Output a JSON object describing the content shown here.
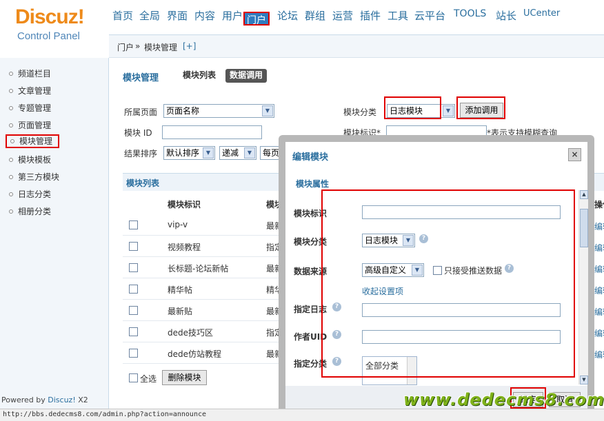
{
  "brand": {
    "logo": "Discuz!",
    "subtitle": "Control Panel"
  },
  "topnav": [
    "首页",
    "全局",
    "界面",
    "内容",
    "用户",
    "门户",
    "论坛",
    "群组",
    "运营",
    "插件",
    "工具",
    "云平台",
    "TOOLS",
    "站长",
    "UCenter"
  ],
  "active_nav": "门户",
  "breadcrumb": {
    "section": "门户",
    "sep": "»",
    "page": "模块管理",
    "add": "[+]"
  },
  "sidebar": [
    "频道栏目",
    "文章管理",
    "专题管理",
    "页面管理",
    "模块管理",
    "模块模板",
    "第三方模块",
    "日志分类",
    "相册分类"
  ],
  "active_sidebar": "模块管理",
  "powered": {
    "prefix": "Powered by",
    "brand": "Discuz!",
    "version": "X2"
  },
  "status_url": "http://bbs.dedecms8.com/admin.php?action=announce",
  "main": {
    "title": "模块管理",
    "tabs": [
      "模块列表",
      "数据调用"
    ],
    "active_tab": "数据调用",
    "filters": {
      "page_label": "所属页面",
      "page_value": "页面名称",
      "id_label": "模块 ID",
      "sort_label": "结果排序",
      "sort_value": "默认排序",
      "order_value": "递减",
      "perpage_value": "每页",
      "category_label": "模块分类",
      "category_value": "日志模块",
      "add_button": "添加调用",
      "tag_label": "模块标识*",
      "tag_hint": "*表示支持模糊查询"
    },
    "list_title": "模块列表",
    "columns": [
      "模块标识",
      "模块",
      "操作"
    ],
    "rows": [
      {
        "name": "vip-v",
        "type": "最新"
      },
      {
        "name": "视频教程",
        "type": "指定"
      },
      {
        "name": "长标题-论坛新帖",
        "type": "最新"
      },
      {
        "name": "精华帖",
        "type": "精华"
      },
      {
        "name": "最新贴",
        "type": "最新"
      },
      {
        "name": "dede技巧区",
        "type": "指定"
      },
      {
        "name": "dede仿站教程",
        "type": "最新"
      }
    ],
    "row_action": "编辑",
    "select_all": "全选",
    "delete_button": "删除模块"
  },
  "dialog": {
    "title": "编辑模块",
    "close": "×",
    "section": "模块属性",
    "fields": {
      "tag_label": "模块标识",
      "category_label": "模块分类",
      "category_value": "日志模块",
      "source_label": "数据来源",
      "source_value": "高级自定义",
      "push_only": "只接受推送数据",
      "collapse_link": "收起设置项",
      "blog_label": "指定日志",
      "uid_label": "作者UID",
      "class_label": "指定分类",
      "class_option": "全部分类"
    },
    "ok": "确定",
    "cancel": "取消"
  },
  "watermark": "www.dedecms8.com",
  "colors": {
    "accent": "#2a6e9e",
    "highlight": "#e00000",
    "logo": "#ee8a1a",
    "watermark": "#7fb21a"
  }
}
